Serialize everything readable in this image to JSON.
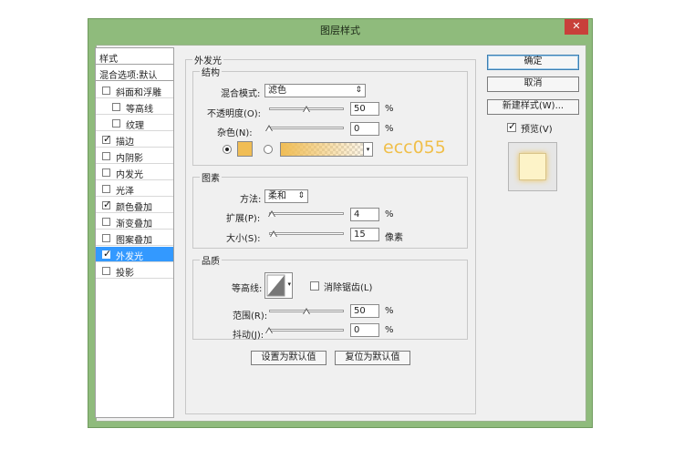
{
  "window": {
    "title": "图层样式",
    "close_glyph": "✕"
  },
  "styles_list": {
    "header": "样式",
    "blend_default": "混合选项:默认",
    "items": [
      {
        "label": "斜面和浮雕",
        "checked": false
      },
      {
        "label": "等高线",
        "checked": false
      },
      {
        "label": "纹理",
        "checked": false
      },
      {
        "label": "描边",
        "checked": true
      },
      {
        "label": "内阴影",
        "checked": false
      },
      {
        "label": "内发光",
        "checked": false
      },
      {
        "label": "光泽",
        "checked": false
      },
      {
        "label": "颜色叠加",
        "checked": true
      },
      {
        "label": "渐变叠加",
        "checked": false
      },
      {
        "label": "图案叠加",
        "checked": false
      },
      {
        "label": "外发光",
        "checked": true
      },
      {
        "label": "投影",
        "checked": false
      }
    ],
    "check_glyph": "✓"
  },
  "outer_glow": {
    "panel_title": "外发光",
    "structure": {
      "title": "结构",
      "blend_mode_label": "混合模式:",
      "blend_mode_value": "滤色",
      "opacity_label": "不透明度(O):",
      "opacity_value": "50",
      "opacity_level": 50,
      "noise_label": "杂色(N):",
      "noise_value": "0",
      "noise_level": 0,
      "percent": "%",
      "color_hex": "#f0bd55",
      "gradient_color": "#f0bd55",
      "annotation": "ecc055",
      "annotation_color": "#f0bf4a"
    },
    "elements": {
      "title": "图素",
      "technique_label": "方法:",
      "technique_value": "柔和",
      "spread_label": "扩展(P):",
      "spread_value": "4",
      "spread_level": 4,
      "size_label": "大小(S):",
      "size_value": "15",
      "size_level": 6,
      "percent": "%",
      "pixel_unit": "像素"
    },
    "quality": {
      "title": "品质",
      "contour_label": "等高线:",
      "anti_alias_label": "消除锯齿(L)",
      "anti_alias_checked": false,
      "range_label": "范围(R):",
      "range_value": "50",
      "range_level": 50,
      "jitter_label": "抖动(J):",
      "jitter_value": "0",
      "jitter_level": 0,
      "percent": "%"
    },
    "make_default_button": "设置为默认值",
    "reset_default_button": "复位为默认值"
  },
  "buttons": {
    "ok": "确定",
    "cancel": "取消",
    "new_style": "新建样式(W)...",
    "preview_label": "预览(V)",
    "preview_checked": true
  },
  "colors": {
    "window_frame": "#8fbb7c",
    "selection": "#3399ff",
    "preview_swatch": "#fdf3c8"
  }
}
